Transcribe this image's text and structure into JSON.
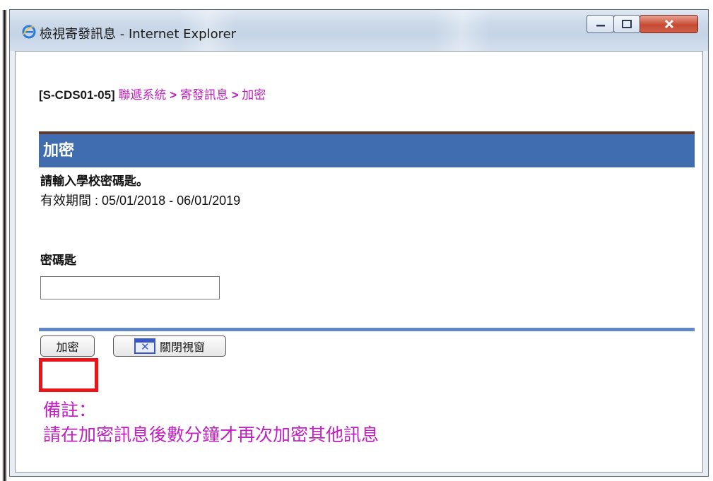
{
  "window": {
    "title": "檢視寄發訊息 - Internet Explorer",
    "minimize_label": "—",
    "maximize_label": "☐",
    "close_label": "✕"
  },
  "breadcrumb": {
    "code": "[S-CDS01-05]",
    "items": [
      "聯遞系統",
      "寄發訊息",
      "加密"
    ],
    "separator": ">"
  },
  "section": {
    "title": "加密",
    "instruction": "請輸入學校密碼匙。",
    "validity": "有效期間 : 05/01/2018 - 06/01/2019"
  },
  "form": {
    "password_label": "密碼匙",
    "password_value": ""
  },
  "actions": {
    "encrypt_label": "加密",
    "close_window_label": "關閉視窗"
  },
  "note": {
    "title": "備註：",
    "text": "請在加密訊息後數分鐘才再次加密其他訊息"
  },
  "colors": {
    "header_bg": "#3f6db0",
    "breadcrumb_link": "#c020c0",
    "note_text": "#c020c0",
    "highlight": "#e8141a"
  }
}
